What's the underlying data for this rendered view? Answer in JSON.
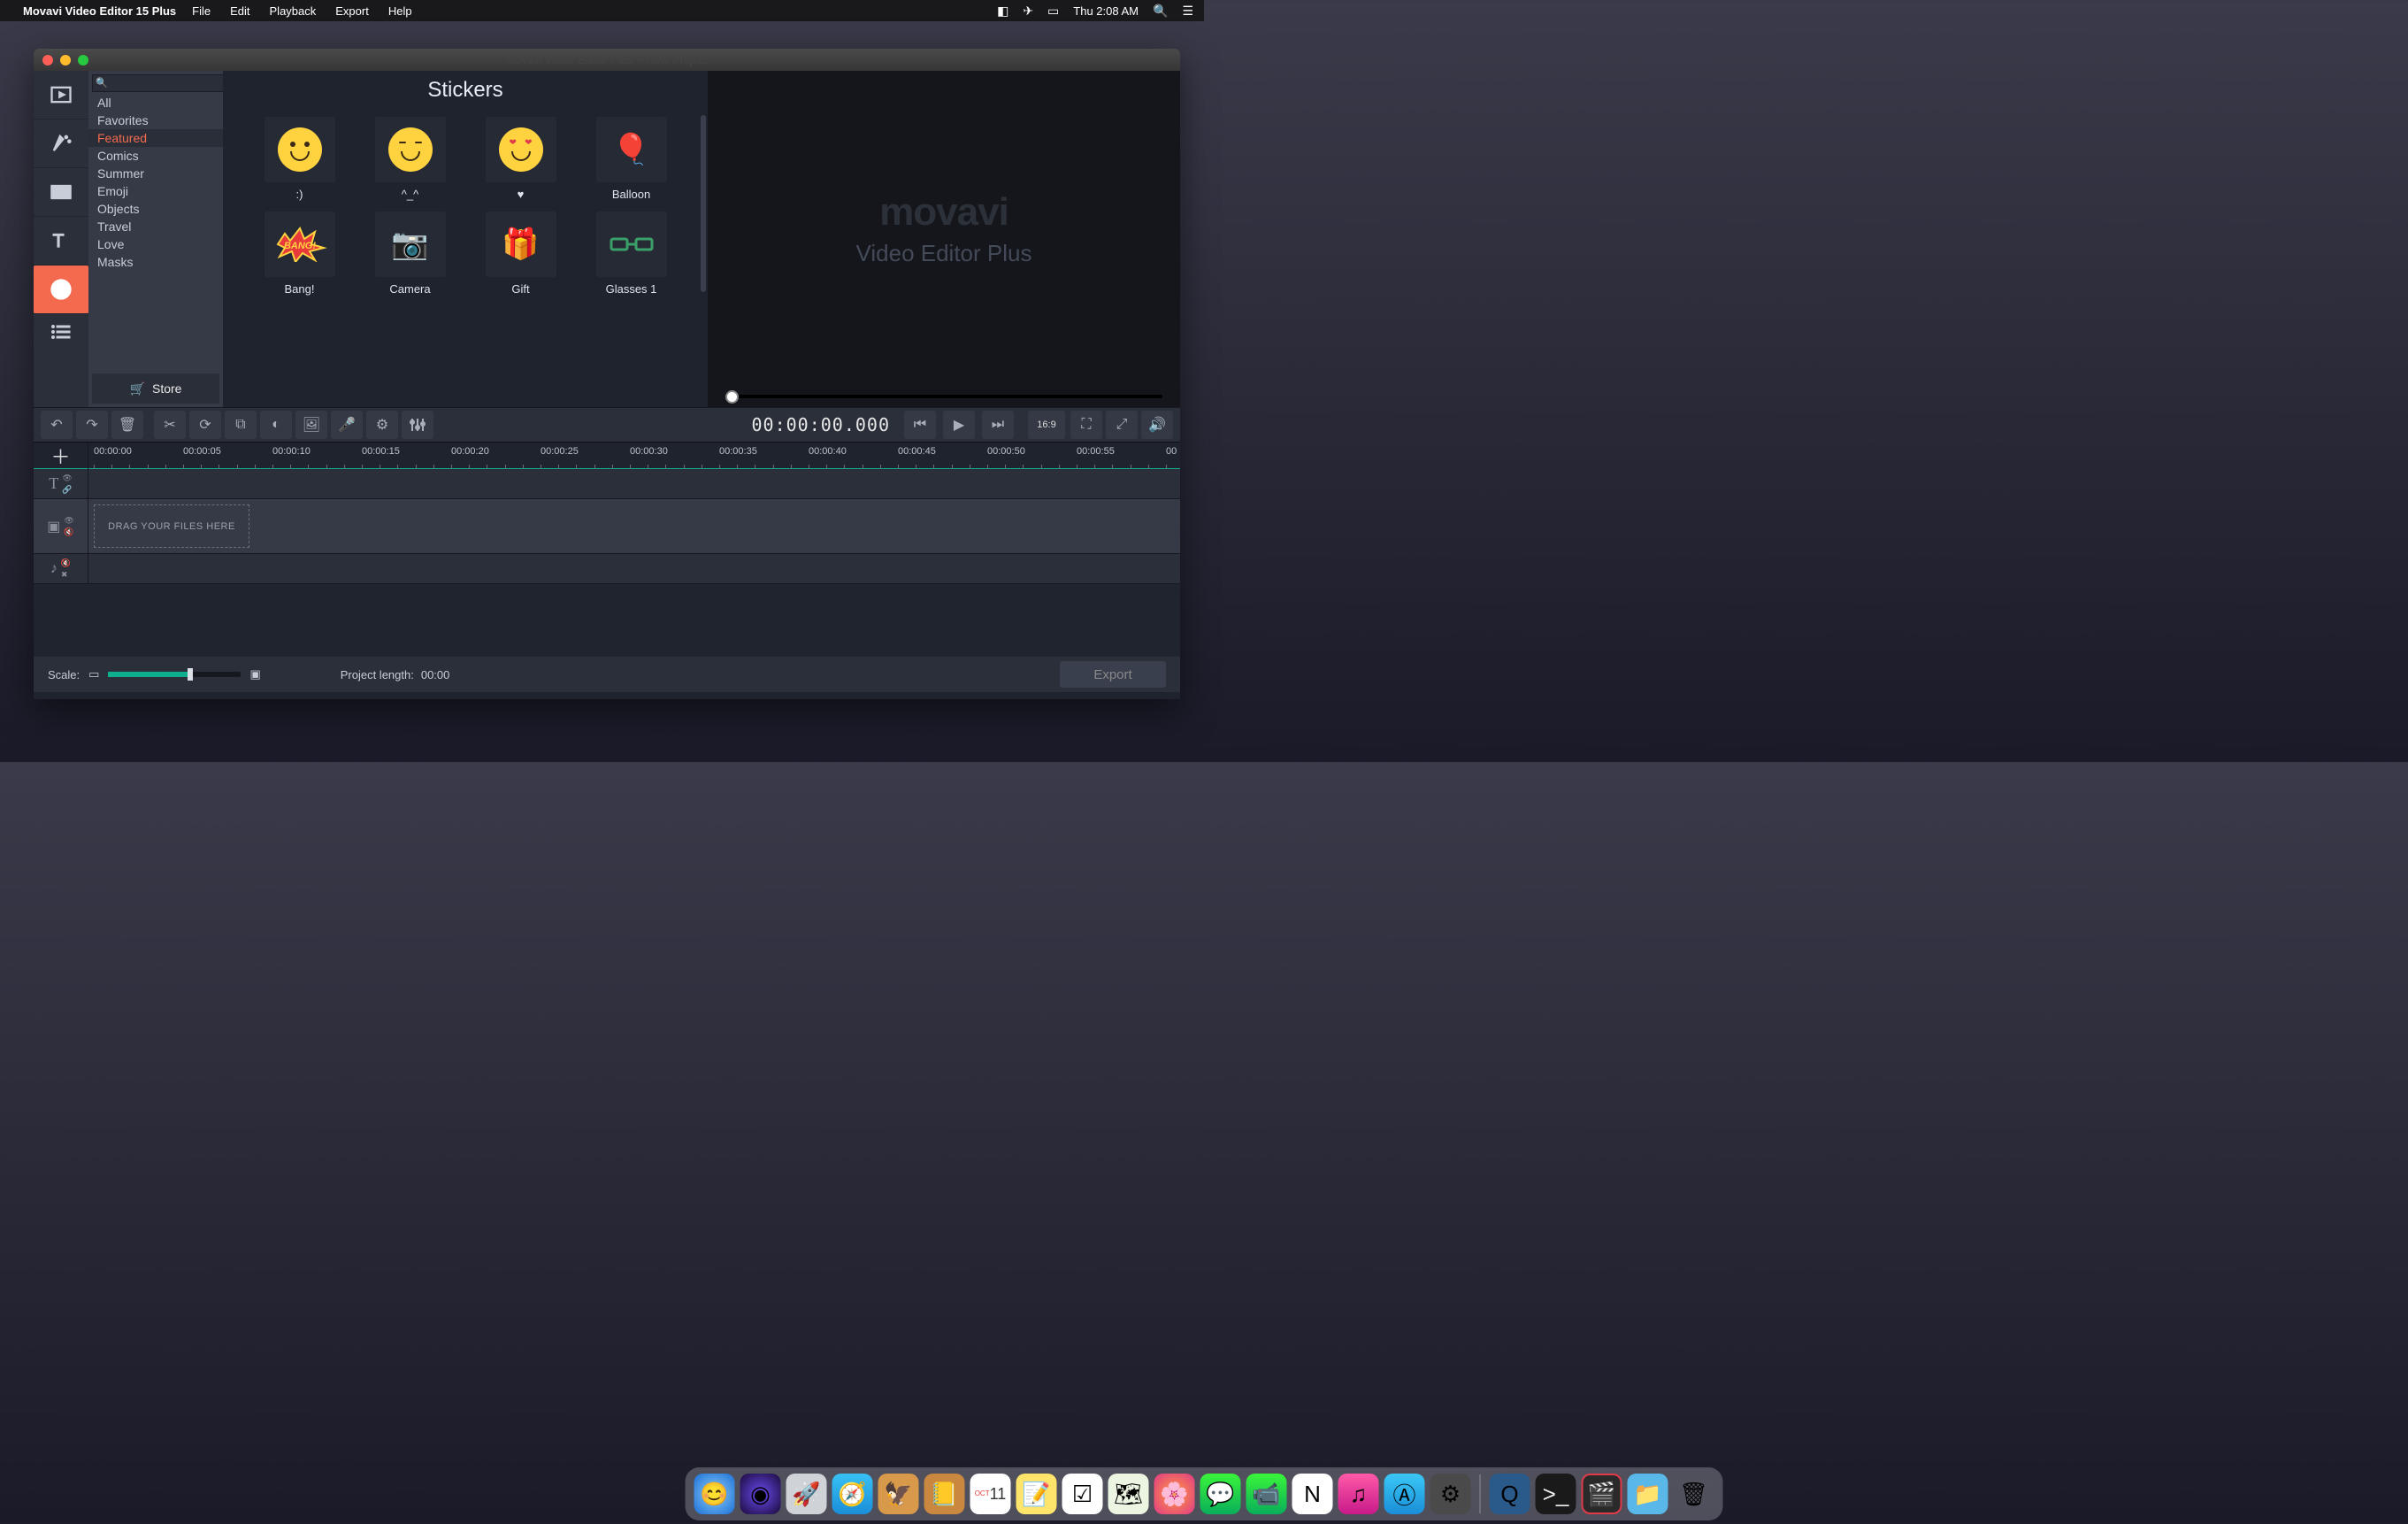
{
  "menubar": {
    "app": "Movavi Video Editor 15 Plus",
    "items": [
      "File",
      "Edit",
      "Playback",
      "Export",
      "Help"
    ],
    "clock": "Thu 2:08 AM"
  },
  "window": {
    "title": "Movavi Video Editor Plus – New Project"
  },
  "sidebar_tools": [
    "media",
    "effects",
    "transitions",
    "titles",
    "stickers"
  ],
  "categories": {
    "search_placeholder": "",
    "items": [
      "All",
      "Favorites",
      "Featured",
      "Comics",
      "Summer",
      "Emoji",
      "Objects",
      "Travel",
      "Love",
      "Masks"
    ],
    "selected": "Featured",
    "store": "Store"
  },
  "grid": {
    "title": "Stickers",
    "items": [
      {
        "label": ":)",
        "icon": "smile"
      },
      {
        "label": "^_^",
        "icon": "happy"
      },
      {
        "label": "♥",
        "icon": "love"
      },
      {
        "label": "Balloon",
        "icon": "balloon"
      },
      {
        "label": "Bang!",
        "icon": "bang"
      },
      {
        "label": "Camera",
        "icon": "camera"
      },
      {
        "label": "Gift",
        "icon": "gift"
      },
      {
        "label": "Glasses 1",
        "icon": "glasses"
      }
    ]
  },
  "preview": {
    "brand": "movavi",
    "sub": "Video Editor Plus"
  },
  "timecode": "00:00:00.000",
  "aspect": "16:9",
  "ruler": [
    "00:00:00",
    "00:00:05",
    "00:00:10",
    "00:00:15",
    "00:00:20",
    "00:00:25",
    "00:00:30",
    "00:00:35",
    "00:00:40",
    "00:00:45",
    "00:00:50",
    "00:00:55",
    "00"
  ],
  "dropzone": "DRAG YOUR FILES HERE",
  "bottom": {
    "scale_label": "Scale:",
    "proj_label": "Project length:",
    "proj_value": "00:00",
    "export": "Export"
  }
}
